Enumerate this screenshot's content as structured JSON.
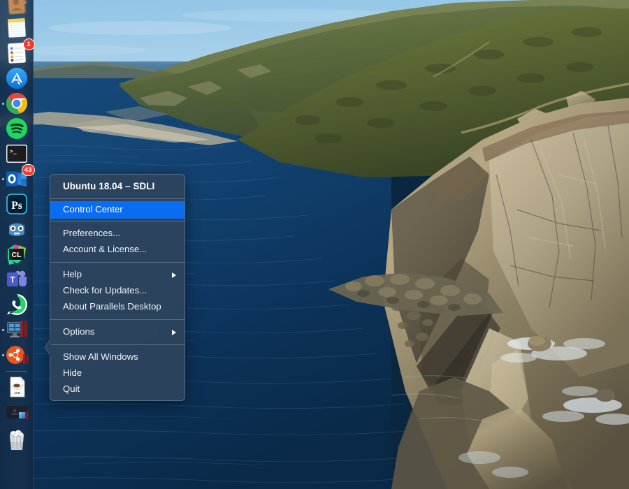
{
  "desktop": {
    "wallpaper_name": "catalina-coastline-wallpaper",
    "colors": {
      "sky_top": "#8fc4e8",
      "sky_bottom": "#cfe3ef",
      "sea_far": "#4a7fa6",
      "sea_near": "#0d2d52",
      "sea_deep": "#0a2340",
      "hill_green": "#5f6b36",
      "hill_dark": "#44512c",
      "rock_tan": "#a89274",
      "rock_light": "#c8bb9c",
      "rock_shadow": "#5b5342",
      "foam": "#e8f1f6"
    }
  },
  "dock": {
    "name": "macos-dock",
    "position": "left",
    "items": [
      {
        "name": "contacts",
        "label": "Contacts",
        "icon": "contacts-icon",
        "running": false,
        "badge": null
      },
      {
        "name": "notes",
        "label": "Notes",
        "icon": "notes-icon",
        "running": false,
        "badge": null
      },
      {
        "name": "reminders",
        "label": "Reminders",
        "icon": "reminders-icon",
        "running": false,
        "badge": "1"
      },
      {
        "name": "app-store",
        "label": "App Store",
        "icon": "app-store-icon",
        "running": false,
        "badge": null
      },
      {
        "name": "google-chrome",
        "label": "Google Chrome",
        "icon": "chrome-icon",
        "running": true,
        "badge": null
      },
      {
        "name": "spotify",
        "label": "Spotify",
        "icon": "spotify-icon",
        "running": false,
        "badge": null
      },
      {
        "name": "terminal",
        "label": "Terminal",
        "icon": "terminal-icon",
        "running": false,
        "badge": null
      },
      {
        "name": "outlook",
        "label": "Microsoft Outlook",
        "icon": "outlook-icon",
        "running": true,
        "badge": "43"
      },
      {
        "name": "photoshop",
        "label": "Adobe Photoshop",
        "icon": "photoshop-icon",
        "running": false,
        "badge": null
      },
      {
        "name": "godot",
        "label": "Godot Engine",
        "icon": "godot-icon",
        "running": false,
        "badge": null
      },
      {
        "name": "clion",
        "label": "CLion",
        "icon": "clion-icon",
        "running": false,
        "badge": null
      },
      {
        "name": "microsoft-teams",
        "label": "Microsoft Teams",
        "icon": "teams-icon",
        "running": false,
        "badge": null
      },
      {
        "name": "whatsapp",
        "label": "WhatsApp",
        "icon": "whatsapp-icon",
        "running": false,
        "badge": null
      },
      {
        "name": "parallels-windows-vm",
        "label": "Windows",
        "icon": "parallels-windows-icon",
        "running": true,
        "badge": null
      },
      {
        "name": "parallels-ubuntu-vm",
        "label": "Ubuntu 18.04 - SDLI",
        "icon": "parallels-ubuntu-icon",
        "running": true,
        "badge": null
      }
    ],
    "separator": true,
    "files": [
      {
        "name": "jar-file",
        "label": "JAR file",
        "icon": "jar-document-icon"
      },
      {
        "name": "screenshot-file",
        "label": "Screenshot",
        "icon": "screenshot-thumbnail-icon"
      }
    ],
    "trash": {
      "name": "trash",
      "label": "Trash",
      "icon": "trash-icon"
    }
  },
  "context_menu": {
    "name": "parallels-dock-context-menu",
    "header": "Ubuntu 18.04 – SDLI",
    "highlight_color": "#0a6cf1",
    "groups": [
      {
        "items": [
          {
            "label": "Control Center",
            "selected": true,
            "submenu": false
          }
        ]
      },
      {
        "items": [
          {
            "label": "Preferences...",
            "selected": false,
            "submenu": false
          },
          {
            "label": "Account & License...",
            "selected": false,
            "submenu": false
          }
        ]
      },
      {
        "items": [
          {
            "label": "Help",
            "selected": false,
            "submenu": true
          },
          {
            "label": "Check for Updates...",
            "selected": false,
            "submenu": false
          },
          {
            "label": "About Parallels Desktop",
            "selected": false,
            "submenu": false
          }
        ]
      },
      {
        "items": [
          {
            "label": "Options",
            "selected": false,
            "submenu": true
          }
        ]
      },
      {
        "items": [
          {
            "label": "Show All Windows",
            "selected": false,
            "submenu": false
          },
          {
            "label": "Hide",
            "selected": false,
            "submenu": false
          },
          {
            "label": "Quit",
            "selected": false,
            "submenu": false
          }
        ]
      }
    ]
  }
}
